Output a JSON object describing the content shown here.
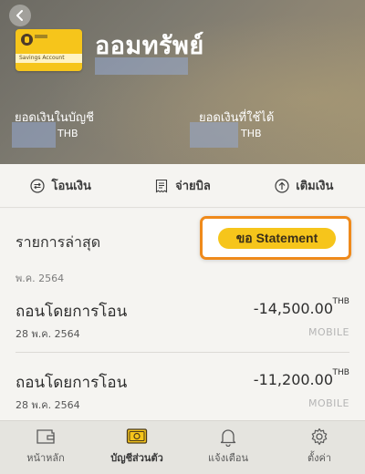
{
  "header": {
    "account_title": "ออมทรัพย์",
    "card_name": "Savings Account",
    "balance_label": "ยอดเงินในบัญชี",
    "available_label": "ยอดเงินที่ใช้ได้",
    "balance_currency": "THB",
    "available_currency": "THB"
  },
  "actions": [
    {
      "label": "โอนเงิน",
      "icon": "transfer-icon"
    },
    {
      "label": "จ่ายบิล",
      "icon": "bill-icon"
    },
    {
      "label": "เติมเงิน",
      "icon": "topup-icon"
    }
  ],
  "transactions": {
    "title": "รายการล่าสุด",
    "statement_button": "ขอ Statement",
    "month": "พ.ค. 2564",
    "items": [
      {
        "name": "ถอนโดยการโอน",
        "date": "28 พ.ค. 2564",
        "amount": "-14,500.00",
        "currency": "THB",
        "channel": "MOBILE"
      },
      {
        "name": "ถอนโดยการโอน",
        "date": "28 พ.ค. 2564",
        "amount": "-11,200.00",
        "currency": "THB",
        "channel": "MOBILE"
      }
    ]
  },
  "bottom_nav": [
    {
      "label": "หน้าหลัก",
      "icon": "wallet-icon",
      "active": false
    },
    {
      "label": "บัญชีส่วนตัว",
      "icon": "account-card-icon",
      "active": true
    },
    {
      "label": "แจ้งเตือน",
      "icon": "bell-icon",
      "active": false
    },
    {
      "label": "ตั้งค่า",
      "icon": "gear-icon",
      "active": false
    }
  ],
  "colors": {
    "accent": "#f6c51b",
    "highlight": "#ef8a1b"
  }
}
